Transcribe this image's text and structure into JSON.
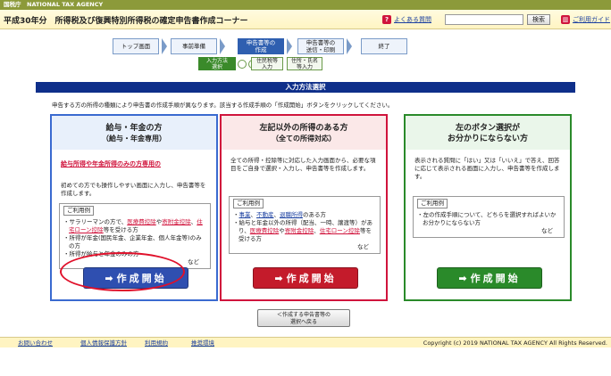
{
  "topbar": {
    "label": "国税庁　NATIONAL TAX AGENCY"
  },
  "header": {
    "title": "平成30年分　所得税及び復興特別所得税の確定申告書作成コーナー",
    "faq": "よくある質問",
    "search_button": "検索",
    "guide": "ご利用ガイド",
    "faq_icon": "question-icon",
    "guide_icon": "book-icon"
  },
  "steps": [
    {
      "label": "トップ画面"
    },
    {
      "label": "事前準備"
    },
    {
      "label1": "申告書等の",
      "label2": "作成"
    },
    {
      "label1": "申告書等の",
      "label2": "送信・印刷"
    },
    {
      "label": "終了"
    }
  ],
  "substeps": [
    {
      "label1": "入力方法",
      "label2": "選択"
    },
    {
      "label1": "住民税等",
      "label2": "入力"
    },
    {
      "label1": "住所・氏名",
      "label2": "等入力"
    }
  ],
  "section_title": "入力方法選択",
  "instruction": "申告する方の所得の種類により申告書の作成手順が異なります。該当する作成手順の「作成開始」ボタンをクリックしてください。",
  "panels": [
    {
      "title": "給与・年金の方",
      "subtitle": "（給与・年金専用）",
      "desc": "給与所得や年金所得のみの方専用の",
      "desc2": "初めての方でも操作しやすい画面に入力し、申告書等を作成します。",
      "example_label": "ご利用例",
      "examples": [
        {
          "pre": "・サラリーマンの方で、",
          "red": "医療費控除",
          "mid": "や",
          "red2": "寄附金控除",
          "mid2": "、",
          "red3": "住宅ローン控除",
          "post": "等を受ける方"
        },
        {
          "text": "・所得が年金(国民年金、企業年金、個人年金等)のみの方"
        },
        {
          "text": "・所得が給与と年金のみの方"
        }
      ],
      "nado": "など",
      "button": "作成開始",
      "color": "#2f4fb0"
    },
    {
      "title": "左記以外の所得のある方",
      "subtitle": "（全ての所得対応）",
      "desc": "全ての所得・控除等に対応した入力画面から、必要な項目をご自身で選択・入力し、申告書等を作成します。",
      "example_label": "ご利用例",
      "ex1": {
        "pre": "・",
        "b1": "事業",
        "s1": "、",
        "b2": "不動産",
        "s2": "、",
        "b3": "退職所得",
        "post": "のある方"
      },
      "ex2": {
        "pre": "・給与と年金以外の所得（配当、一時、譲渡等）があり、",
        "red": "医療費控除",
        "mid": "や",
        "red2": "寄附金控除",
        "mid2": "、",
        "red3": "住宅ローン控除",
        "post": "等を受ける方"
      },
      "nado": "など",
      "button": "作成開始",
      "color": "#c41b2b"
    },
    {
      "title1": "左のボタン選択が",
      "title2": "お分かりにならない方",
      "desc": "表示される質問に「はい」又は「いいえ」で答え、回答に応じて表示される画面に入力し、申告書等を作成します。",
      "example_label": "ご利用例",
      "ex1": "・左の作成手順について、どちらを選択すればよいかお分かりにならない方",
      "nado": "など",
      "button": "作成開始",
      "color": "#2a8a2a"
    }
  ],
  "back_button": {
    "line1": "＜作成する申告書等の",
    "line2": "選択へ戻る"
  },
  "footer": {
    "links": [
      "お問い合わせ",
      "個人情報保護方針",
      "利用規約",
      "推奨環境"
    ],
    "copyright": "Copyright (c) 2019 NATIONAL TAX AGENCY All Rights Reserved."
  }
}
